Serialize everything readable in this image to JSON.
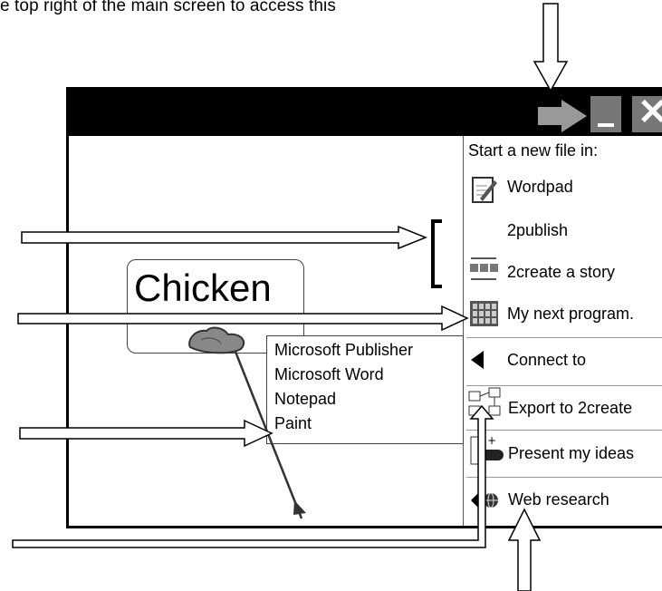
{
  "caption": "e top right of the main screen to access this",
  "node": {
    "title": "Chicken"
  },
  "side_panel": {
    "heading": "Start a new file in:",
    "items": [
      {
        "label": "Wordpad",
        "icon": "notepad-icon"
      },
      {
        "label": "2publish",
        "icon": ""
      },
      {
        "label": "2create a story",
        "icon": "story-icon"
      },
      {
        "label": "My next program.",
        "icon": "grid-icon"
      },
      {
        "label": "Connect to",
        "icon": "triangle-left-icon"
      },
      {
        "label": "Export to 2create",
        "icon": "export-icon"
      },
      {
        "label": "Present my ideas",
        "icon": "present-icon"
      },
      {
        "label": "Web research",
        "icon": "globe-icon"
      }
    ]
  },
  "context_menu": {
    "items": [
      "Microsoft Publisher",
      "Microsoft Word",
      "Notepad",
      "Paint"
    ]
  }
}
